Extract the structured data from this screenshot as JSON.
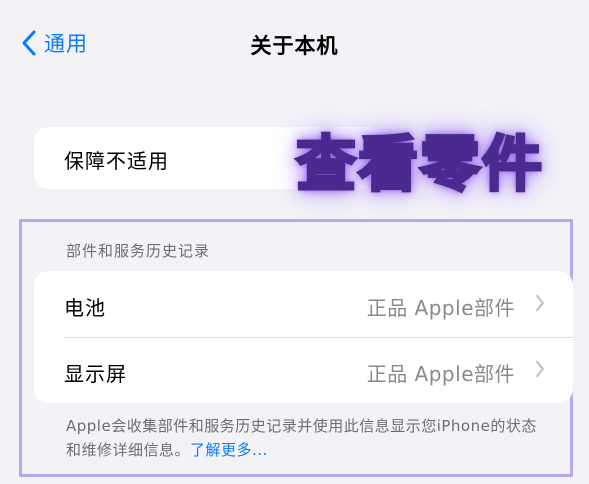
{
  "nav": {
    "back_label": "通用",
    "title": "关于本机"
  },
  "top_card": {
    "label": "保障不适用"
  },
  "overlay": {
    "text": "查看零件"
  },
  "section": {
    "header": "部件和服务历史记录",
    "rows": [
      {
        "label": "电池",
        "value": "正品 Apple部件"
      },
      {
        "label": "显示屏",
        "value": "正品 Apple部件"
      }
    ],
    "footer_text": "Apple会收集部件和服务历史记录并使用此信息显示您iPhone的状态和维修详细信息。",
    "footer_link": "了解更多..."
  },
  "colors": {
    "accent": "#0a7aff",
    "background": "#f2f2f7",
    "secondary_text": "#6d6d72",
    "highlight_frame": "#b9a8ef"
  },
  "icons": {
    "back": "chevron-left-icon",
    "row_disclosure": "chevron-right-icon"
  }
}
